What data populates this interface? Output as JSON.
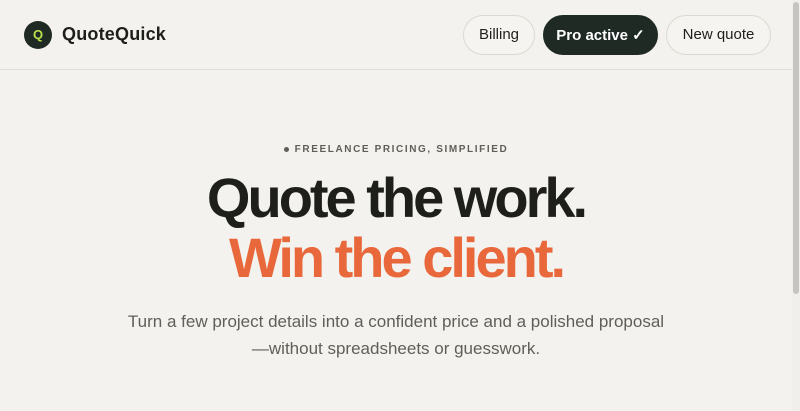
{
  "brand": {
    "logo_letter": "Q",
    "name": "QuoteQuick"
  },
  "nav": {
    "billing": "Billing",
    "pro": "Pro active ✓",
    "new_quote": "New quote"
  },
  "hero": {
    "eyebrow": "FREELANCE PRICING, SIMPLIFIED",
    "headline_line1": "Quote the work.",
    "headline_line2": "Win the client.",
    "sub_line1": "Turn a few project details into a confident price and a polished proposal",
    "sub_line2": "—without spreadsheets or guesswork."
  },
  "colors": {
    "accent": "#e8673b",
    "dark": "#1f2a24",
    "logo_letter": "#b8e04a",
    "background": "#f4f2ee"
  }
}
